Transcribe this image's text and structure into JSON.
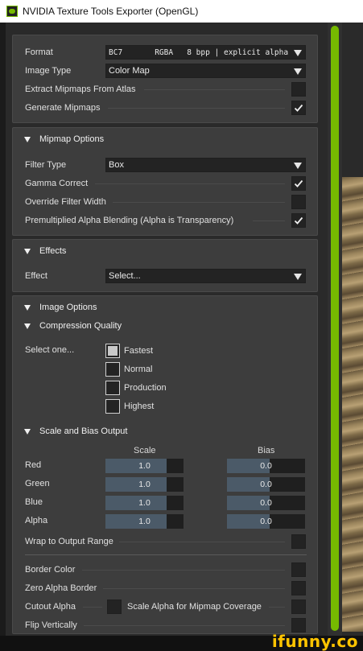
{
  "window": {
    "title": "NVIDIA Texture Tools Exporter (OpenGL)"
  },
  "colors": {
    "accent": "#76b900",
    "panel": "#3d3d3d",
    "field": "#232323",
    "slider_fill": "#4b5a68",
    "watermark": "#ffc400"
  },
  "format_panel": {
    "format_label": "Format",
    "format_value": "BC7       RGBA   8 bpp | explicit alpha",
    "image_type_label": "Image Type",
    "image_type_value": "Color Map",
    "extract_mipmaps_label": "Extract Mipmaps From Atlas",
    "extract_mipmaps_checked": false,
    "generate_mipmaps_label": "Generate Mipmaps",
    "generate_mipmaps_checked": true
  },
  "mipmap_options": {
    "title": "Mipmap Options",
    "filter_type_label": "Filter Type",
    "filter_type_value": "Box",
    "gamma_correct_label": "Gamma Correct",
    "gamma_correct_checked": true,
    "override_filter_width_label": "Override Filter Width",
    "override_filter_width_checked": false,
    "premultiplied_label": "Premultiplied Alpha Blending (Alpha is Transparency)",
    "premultiplied_checked": true
  },
  "effects": {
    "title": "Effects",
    "effect_label": "Effect",
    "effect_value": "Select..."
  },
  "image_options": {
    "title": "Image Options",
    "compression_quality_title": "Compression Quality",
    "select_one_label": "Select one...",
    "quality_options": [
      "Fastest",
      "Normal",
      "Production",
      "Highest"
    ],
    "quality_selected_index": 0,
    "scale_bias_title": "Scale and Bias Output",
    "scale_header": "Scale",
    "bias_header": "Bias",
    "channels": [
      {
        "label": "Red",
        "scale": "1.0",
        "bias": "0.0"
      },
      {
        "label": "Green",
        "scale": "1.0",
        "bias": "0.0"
      },
      {
        "label": "Blue",
        "scale": "1.0",
        "bias": "0.0"
      },
      {
        "label": "Alpha",
        "scale": "1.0",
        "bias": "0.0"
      }
    ],
    "wrap_label": "Wrap to Output Range",
    "border_color_label": "Border Color",
    "zero_alpha_border_label": "Zero Alpha Border",
    "cutout_alpha_label": "Cutout Alpha",
    "scale_alpha_label": "Scale Alpha for Mipmap Coverage",
    "flip_vertically_label": "Flip Vertically"
  },
  "watermark": "ifunny.co"
}
